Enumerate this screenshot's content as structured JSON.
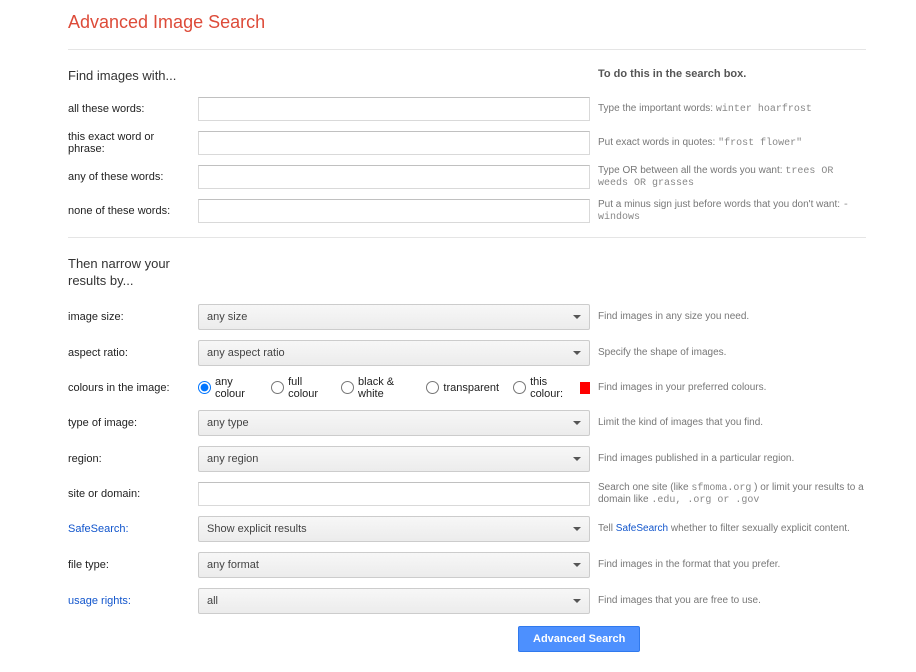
{
  "title": "Advanced Image Search",
  "section1": {
    "heading": "Find images with...",
    "hint_heading": "To do this in the search box."
  },
  "fields": {
    "all_words": {
      "label": "all these words:",
      "value": "",
      "hint_pre": "Type the important words: ",
      "hint_code": "winter hoarfrost"
    },
    "exact": {
      "label": "this exact word or phrase:",
      "value": "",
      "hint_pre": "Put exact words in quotes: ",
      "hint_code": "\"frost flower\""
    },
    "any_words": {
      "label": "any of these words:",
      "value": "",
      "hint_pre": "Type OR between all the words you want: ",
      "hint_code": "trees OR weeds OR grasses"
    },
    "none_words": {
      "label": "none of these words:",
      "value": "",
      "hint_pre": "Put a minus sign just before words that you don't want: ",
      "hint_code": "-windows"
    }
  },
  "section2": {
    "heading": "Then narrow your results by..."
  },
  "narrow": {
    "image_size": {
      "label": "image size:",
      "value": "any size",
      "hint": "Find images in any size you need."
    },
    "aspect": {
      "label": "aspect ratio:",
      "value": "any aspect ratio",
      "hint": "Specify the shape of images."
    },
    "colours": {
      "label": "colours in the image:",
      "hint": "Find images in your preferred colours.",
      "options": {
        "any": "any colour",
        "full": "full colour",
        "bw": "black & white",
        "transparent": "transparent",
        "this": "this colour:"
      }
    },
    "type": {
      "label": "type of image:",
      "value": "any type",
      "hint": "Limit the kind of images that you find."
    },
    "region": {
      "label": "region:",
      "value": "any region",
      "hint": "Find images published in a particular region."
    },
    "site": {
      "label": "site or domain:",
      "value": "",
      "hint_pre": "Search one site (like ",
      "hint_code1": "sfmoma.org",
      "hint_mid": " ) or limit your results to a domain like ",
      "hint_code2": ".edu, .org or .gov"
    },
    "safesearch": {
      "label": "SafeSearch:",
      "value": "Show explicit results",
      "hint_pre": "Tell ",
      "hint_link": "SafeSearch",
      "hint_post": " whether to filter sexually explicit content."
    },
    "filetype": {
      "label": "file type:",
      "value": "any format",
      "hint": "Find images in the format that you prefer."
    },
    "usage": {
      "label": "usage rights:",
      "value": "all",
      "hint": "Find images that you are free to use."
    }
  },
  "button": "Advanced Search"
}
